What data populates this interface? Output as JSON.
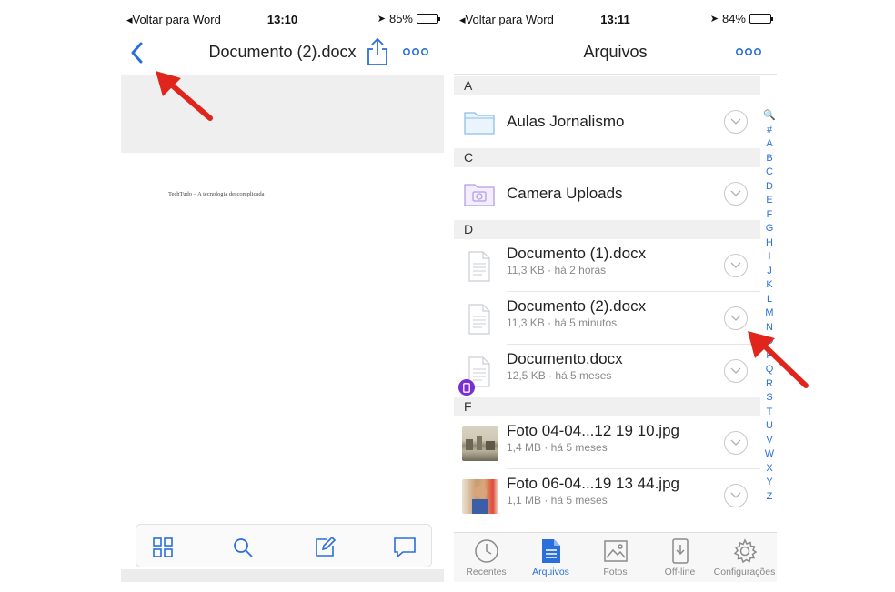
{
  "left": {
    "status": {
      "back": "Voltar para Word",
      "time": "13:10",
      "battery": "85%",
      "battery_level": 0.85
    },
    "title": "Documento (2).docx",
    "doc_text": "TechTudo – A tecnologia descomplicada",
    "icons": {
      "back": "back-chevron-icon",
      "share": "share-icon",
      "more": "more-dots-icon",
      "toolbar": [
        "grid-icon",
        "search-icon",
        "edit-icon",
        "comment-icon"
      ]
    }
  },
  "right": {
    "status": {
      "back": "Voltar para Word",
      "time": "13:11",
      "battery": "84%",
      "battery_level": 0.84
    },
    "title": "Arquivos",
    "sections": [
      {
        "letter": "A",
        "items": [
          {
            "name": "Aulas Jornalismo",
            "meta": "",
            "kind": "folder"
          }
        ]
      },
      {
        "letter": "C",
        "items": [
          {
            "name": "Camera Uploads",
            "meta": "",
            "kind": "camera-folder"
          }
        ]
      },
      {
        "letter": "D",
        "items": [
          {
            "name": "Documento (1).docx",
            "meta": "11,3 KB · há 2 horas",
            "kind": "doc"
          },
          {
            "name": "Documento (2).docx",
            "meta": "11,3 KB · há 5 minutos",
            "kind": "doc"
          },
          {
            "name": "Documento.docx",
            "meta": "12,5 KB · há 5 meses",
            "kind": "doc-offline"
          }
        ]
      },
      {
        "letter": "F",
        "items": [
          {
            "name": "Foto 04-04...12 19 10.jpg",
            "meta": "1,4 MB · há 5 meses",
            "kind": "photo1"
          },
          {
            "name": "Foto 06-04...19 13 44.jpg",
            "meta": "1,1 MB · há 5 meses",
            "kind": "photo2"
          }
        ]
      }
    ],
    "index": [
      "🔍",
      "#",
      "A",
      "B",
      "C",
      "D",
      "E",
      "F",
      "G",
      "H",
      "I",
      "J",
      "K",
      "L",
      "M",
      "N",
      "O",
      "P",
      "Q",
      "R",
      "S",
      "T",
      "U",
      "V",
      "W",
      "X",
      "Y",
      "Z"
    ],
    "tabs": [
      {
        "label": "Recentes",
        "icon": "clock-icon",
        "active": false
      },
      {
        "label": "Arquivos",
        "icon": "file-icon",
        "active": true
      },
      {
        "label": "Fotos",
        "icon": "photo-icon",
        "active": false
      },
      {
        "label": "Off-line",
        "icon": "offline-icon",
        "active": false
      },
      {
        "label": "Configurações",
        "icon": "gear-icon",
        "active": false
      }
    ]
  },
  "colors": {
    "accent": "#2a6fdb",
    "annotation_arrow": "#e0261c"
  }
}
